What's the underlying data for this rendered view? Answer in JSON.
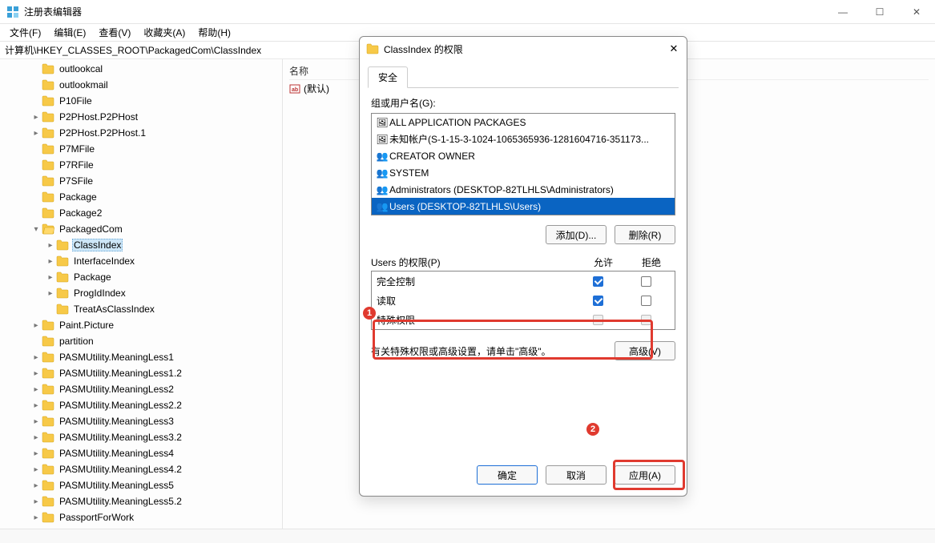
{
  "window": {
    "title": "注册表编辑器",
    "ctrl_min": "—",
    "ctrl_max": "☐",
    "ctrl_close": "✕"
  },
  "menus": {
    "file": "文件(F)",
    "edit": "编辑(E)",
    "view": "查看(V)",
    "fav": "收藏夹(A)",
    "help": "帮助(H)"
  },
  "address": "计算机\\HKEY_CLASSES_ROOT\\PackagedCom\\ClassIndex",
  "values_header": {
    "name": "名称"
  },
  "values": {
    "default_name": "(默认)"
  },
  "tree": [
    {
      "label": "outlookcal",
      "indent": 2,
      "chev": ""
    },
    {
      "label": "outlookmail",
      "indent": 2,
      "chev": ""
    },
    {
      "label": "P10File",
      "indent": 2,
      "chev": ""
    },
    {
      "label": "P2PHost.P2PHost",
      "indent": 2,
      "chev": ">"
    },
    {
      "label": "P2PHost.P2PHost.1",
      "indent": 2,
      "chev": ">"
    },
    {
      "label": "P7MFile",
      "indent": 2,
      "chev": ""
    },
    {
      "label": "P7RFile",
      "indent": 2,
      "chev": ""
    },
    {
      "label": "P7SFile",
      "indent": 2,
      "chev": ""
    },
    {
      "label": "Package",
      "indent": 2,
      "chev": ""
    },
    {
      "label": "Package2",
      "indent": 2,
      "chev": ""
    },
    {
      "label": "PackagedCom",
      "indent": 2,
      "chev": "v",
      "open": true
    },
    {
      "label": "ClassIndex",
      "indent": 3,
      "chev": ">",
      "sel": true
    },
    {
      "label": "InterfaceIndex",
      "indent": 3,
      "chev": ">"
    },
    {
      "label": "Package",
      "indent": 3,
      "chev": ">"
    },
    {
      "label": "ProgIdIndex",
      "indent": 3,
      "chev": ">"
    },
    {
      "label": "TreatAsClassIndex",
      "indent": 3,
      "chev": ""
    },
    {
      "label": "Paint.Picture",
      "indent": 2,
      "chev": ">"
    },
    {
      "label": "partition",
      "indent": 2,
      "chev": ""
    },
    {
      "label": "PASMUtility.MeaningLess1",
      "indent": 2,
      "chev": ">"
    },
    {
      "label": "PASMUtility.MeaningLess1.2",
      "indent": 2,
      "chev": ">"
    },
    {
      "label": "PASMUtility.MeaningLess2",
      "indent": 2,
      "chev": ">"
    },
    {
      "label": "PASMUtility.MeaningLess2.2",
      "indent": 2,
      "chev": ">"
    },
    {
      "label": "PASMUtility.MeaningLess3",
      "indent": 2,
      "chev": ">"
    },
    {
      "label": "PASMUtility.MeaningLess3.2",
      "indent": 2,
      "chev": ">"
    },
    {
      "label": "PASMUtility.MeaningLess4",
      "indent": 2,
      "chev": ">"
    },
    {
      "label": "PASMUtility.MeaningLess4.2",
      "indent": 2,
      "chev": ">"
    },
    {
      "label": "PASMUtility.MeaningLess5",
      "indent": 2,
      "chev": ">"
    },
    {
      "label": "PASMUtility.MeaningLess5.2",
      "indent": 2,
      "chev": ">"
    },
    {
      "label": "PassportForWork",
      "indent": 2,
      "chev": ">"
    }
  ],
  "dialog": {
    "title": "ClassIndex 的权限",
    "tab": "安全",
    "group_label": "组或用户名(G):",
    "users": [
      {
        "name": "ALL APPLICATION PACKAGES",
        "icon": "group"
      },
      {
        "name": "未知帐户(S-1-15-3-1024-1065365936-1281604716-351173...",
        "icon": "group"
      },
      {
        "name": "CREATOR OWNER",
        "icon": "users"
      },
      {
        "name": "SYSTEM",
        "icon": "users"
      },
      {
        "name": "Administrators (DESKTOP-82TLHLS\\Administrators)",
        "icon": "users"
      },
      {
        "name": "Users (DESKTOP-82TLHLS\\Users)",
        "icon": "users",
        "sel": true
      }
    ],
    "btn_add": "添加(D)...",
    "btn_remove": "删除(R)",
    "perm_label": "Users 的权限(P)",
    "col_allow": "允许",
    "col_deny": "拒绝",
    "perms": [
      {
        "name": "完全控制",
        "allow": true,
        "deny": false
      },
      {
        "name": "读取",
        "allow": true,
        "deny": false
      },
      {
        "name": "特殊权限",
        "allow": false,
        "deny": false,
        "dis": true
      }
    ],
    "adv_text": "有关特殊权限或高级设置，请单击\"高级\"。",
    "btn_adv": "高级(V)",
    "btn_ok": "确定",
    "btn_cancel": "取消",
    "btn_apply": "应用(A)"
  },
  "callouts": {
    "n1": "1",
    "n2": "2"
  }
}
